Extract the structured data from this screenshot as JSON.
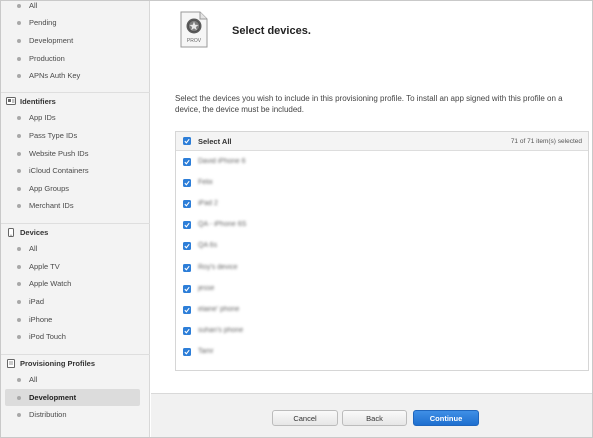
{
  "sidebar": {
    "certificates_items": [
      "All",
      "Pending",
      "Development",
      "Production",
      "APNs Auth Key"
    ],
    "identifiers": {
      "header": "Identifiers",
      "items": [
        "App IDs",
        "Pass Type IDs",
        "Website Push IDs",
        "iCloud Containers",
        "App Groups",
        "Merchant IDs"
      ]
    },
    "devices": {
      "header": "Devices",
      "items": [
        "All",
        "Apple TV",
        "Apple Watch",
        "iPad",
        "iPhone",
        "iPod Touch"
      ]
    },
    "provisioning": {
      "header": "Provisioning Profiles",
      "items": [
        "All",
        "Development",
        "Distribution"
      ],
      "active_item": "Development"
    }
  },
  "main": {
    "icon_label": "PROV",
    "title": "Select devices.",
    "intro": "Select the devices you wish to include in this provisioning profile. To install an app signed with this profile on a device, the device must be included.",
    "select_all_label": "Select All",
    "count_text": "71  of 71 item(s) selected",
    "devices": [
      "David iPhone 6",
      "Felix",
      "iPad 2",
      "QA - iPhone 6S",
      "QA 6s",
      "Roy's device",
      "jesse",
      "elaine' phone",
      "suhan's phone",
      "Tamr"
    ]
  },
  "footer": {
    "cancel_label": "Cancel",
    "back_label": "Back",
    "continue_label": "Continue"
  },
  "colors": {
    "accent": "#2d7ed8",
    "sidebar_bg": "#f3f3f3",
    "footer_bg": "#f1f1f1"
  }
}
